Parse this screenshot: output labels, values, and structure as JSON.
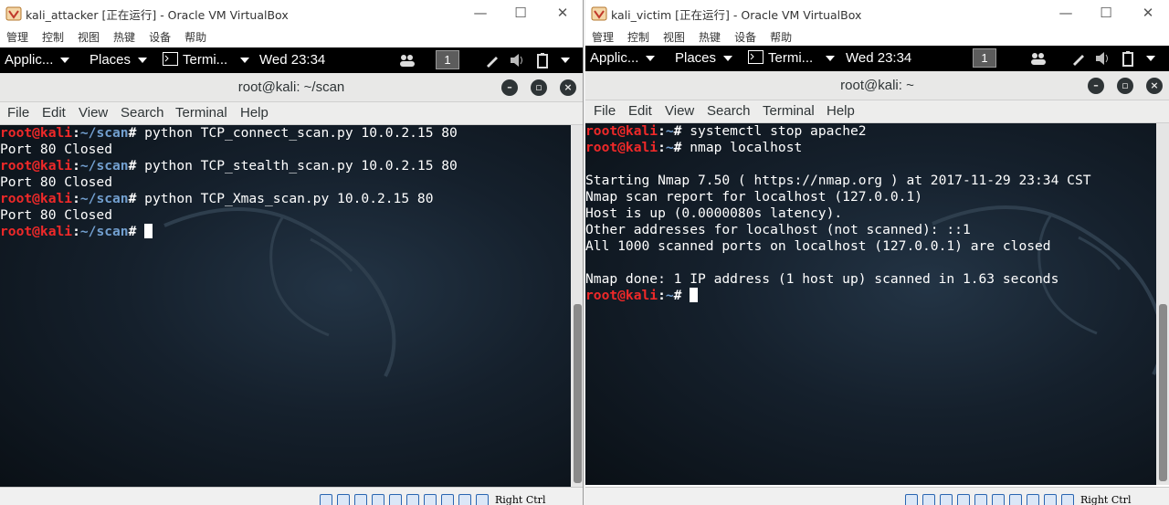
{
  "left": {
    "window_title": "kali_attacker [正在运行] - Oracle VM VirtualBox",
    "vbox_menu": [
      "管理",
      "控制",
      "视图",
      "热键",
      "设备",
      "帮助"
    ],
    "panel": {
      "applications": "Applic...",
      "places": "Places",
      "terminal": "Termi...",
      "clock": "Wed 23:34",
      "workspace": "1"
    },
    "terminal": {
      "title": "root@kali: ~/scan",
      "menu": [
        "File",
        "Edit",
        "View",
        "Search",
        "Terminal",
        "Help"
      ],
      "lines": [
        {
          "user": "root@kali",
          "path": "~/scan",
          "cmd": " python TCP_connect_scan.py 10.0.2.15 80"
        },
        {
          "text": "Port 80 Closed"
        },
        {
          "user": "root@kali",
          "path": "~/scan",
          "cmd": " python TCP_stealth_scan.py 10.0.2.15 80"
        },
        {
          "text": "Port 80 Closed"
        },
        {
          "user": "root@kali",
          "path": "~/scan",
          "cmd": " python TCP_Xmas_scan.py 10.0.2.15 80"
        },
        {
          "text": "Port 80 Closed"
        },
        {
          "user": "root@kali",
          "path": "~/scan",
          "cmd": " ",
          "cursor": true
        }
      ]
    },
    "status_host_key": "Right Ctrl"
  },
  "right": {
    "window_title": "kali_victim [正在运行] - Oracle VM VirtualBox",
    "vbox_menu": [
      "管理",
      "控制",
      "视图",
      "热键",
      "设备",
      "帮助"
    ],
    "panel": {
      "applications": "Applic...",
      "places": "Places",
      "terminal": "Termi...",
      "clock": "Wed 23:34",
      "workspace": "1"
    },
    "terminal": {
      "title": "root@kali: ~",
      "menu": [
        "File",
        "Edit",
        "View",
        "Search",
        "Terminal",
        "Help"
      ],
      "lines": [
        {
          "user": "root@kali",
          "path": "~",
          "cmd": " systemctl stop apache2"
        },
        {
          "user": "root@kali",
          "path": "~",
          "cmd": " nmap localhost"
        },
        {
          "text": ""
        },
        {
          "text": "Starting Nmap 7.50 ( https://nmap.org ) at 2017-11-29 23:34 CST"
        },
        {
          "text": "Nmap scan report for localhost (127.0.0.1)"
        },
        {
          "text": "Host is up (0.0000080s latency)."
        },
        {
          "text": "Other addresses for localhost (not scanned): ::1"
        },
        {
          "text": "All 1000 scanned ports on localhost (127.0.0.1) are closed"
        },
        {
          "text": ""
        },
        {
          "text": "Nmap done: 1 IP address (1 host up) scanned in 1.63 seconds"
        },
        {
          "user": "root@kali",
          "path": "~",
          "cmd": " ",
          "cursor": true
        }
      ]
    },
    "status_host_key": "Right Ctrl"
  },
  "colors": {
    "prompt_user": "#ef2929",
    "prompt_path": "#729fcf",
    "panel_bg": "#000000",
    "terminal_bg": "#15202c"
  }
}
